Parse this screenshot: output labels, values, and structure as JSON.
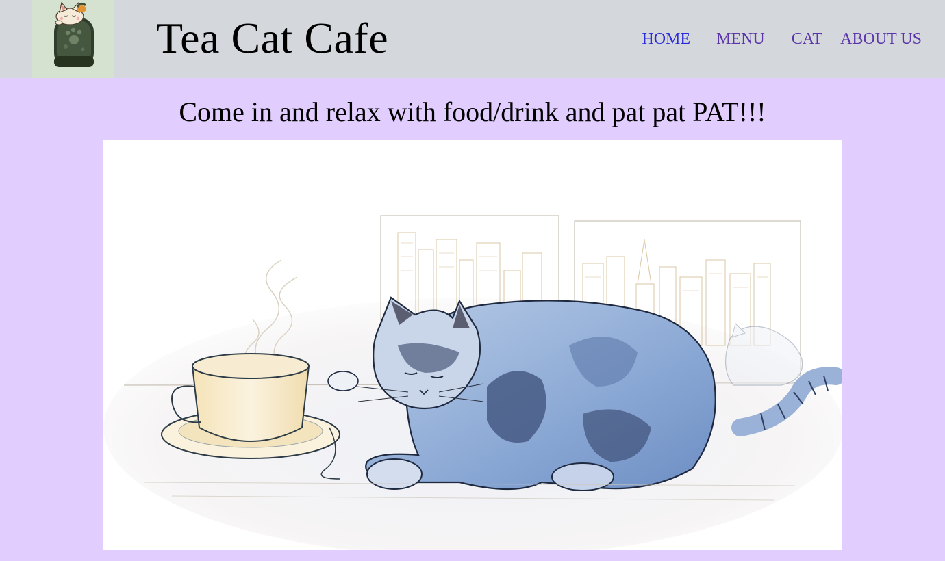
{
  "header": {
    "logo_icon": "cat-in-teacup-logo",
    "title": "Tea Cat Cafe"
  },
  "nav": {
    "items": [
      {
        "label": "HOME",
        "active": true
      },
      {
        "label": "MENU",
        "active": false
      },
      {
        "label": "CAT",
        "active": false
      },
      {
        "label": "ABOUT US",
        "active": false
      }
    ],
    "active_color": "#2b2bd9",
    "link_color": "#5b35a9"
  },
  "main": {
    "tagline": "Come in and relax with food/drink and pat pat PAT!!!",
    "hero_image": "cat-with-teacup-illustration"
  },
  "colors": {
    "page_background": "#e1cdfe",
    "header_background": "#d4d7dc"
  }
}
